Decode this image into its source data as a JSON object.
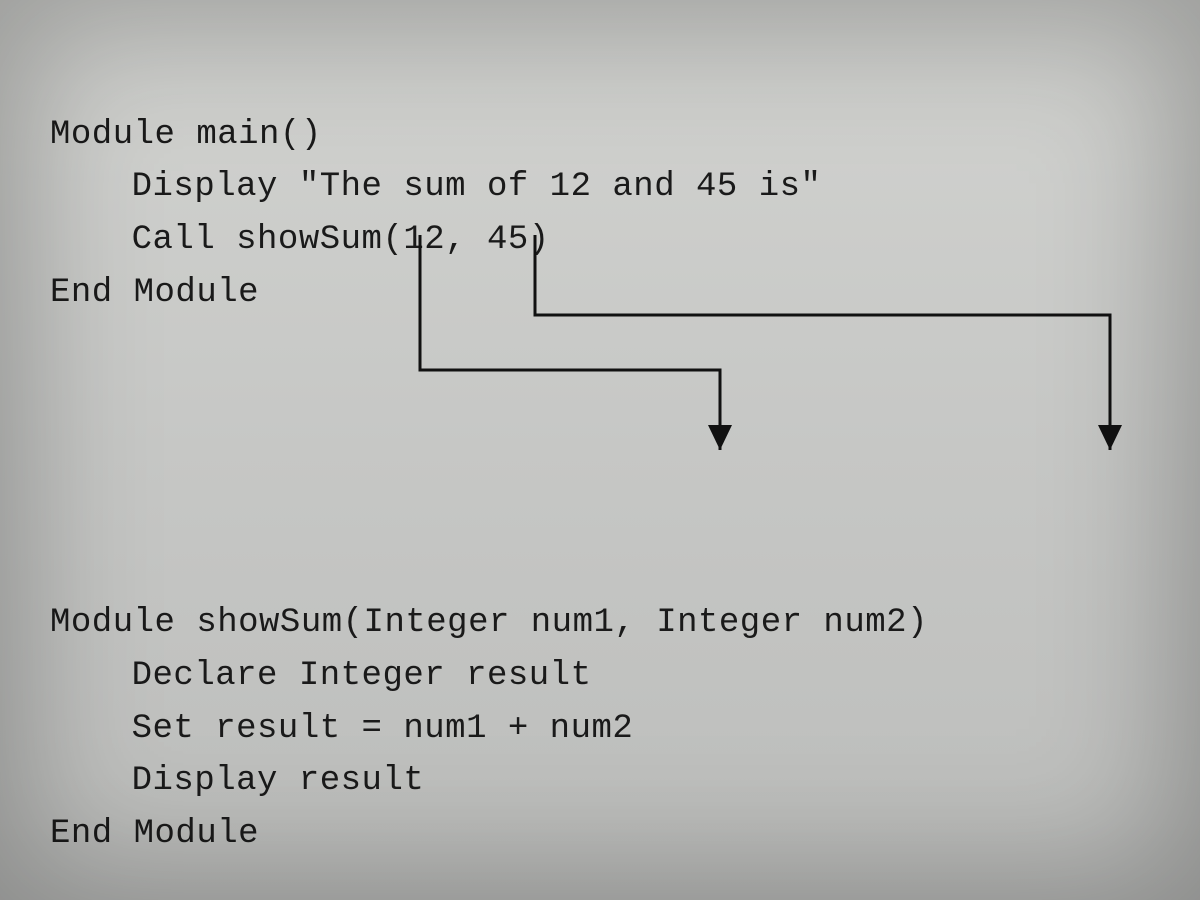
{
  "module_main": {
    "header": "Module main()",
    "line1_prefix": "Display ",
    "line1_string": "\"The sum of 12 and 45 is\"",
    "line2": "Call showSum(12, 45)",
    "end": "End Module"
  },
  "module_showSum": {
    "header": "Module showSum(Integer num1, Integer num2)",
    "line1": "Declare Integer result",
    "line2": "Set result = num1 + num2",
    "line3": "Display result",
    "end": "End Module"
  }
}
